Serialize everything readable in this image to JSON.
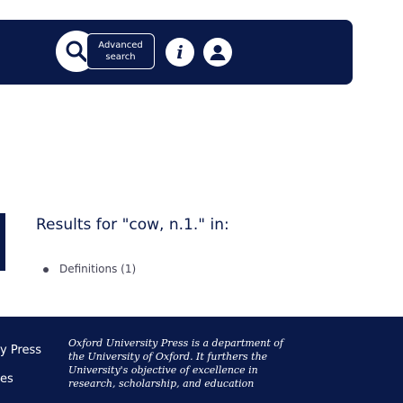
{
  "header": {
    "search_icon": "search-icon",
    "advanced_search": {
      "line1": "Advanced",
      "line2": "search"
    },
    "info_icon": "info-icon",
    "info_glyph": "i",
    "user_icon": "user-icon"
  },
  "results": {
    "title": "Results for \"cow, n.1.\" in:",
    "items": [
      {
        "label": "Definitions (1)"
      }
    ]
  },
  "footer": {
    "nav_items": [
      "y Press",
      "es"
    ],
    "text_lines": [
      "Oxford University Press is a department of",
      "the University of Oxford. It furthers the",
      "University's objective of excellence in",
      "research, scholarship, and education"
    ]
  },
  "colors": {
    "navy": "#0a1a4a",
    "white": "#ffffff",
    "body_text": "#445"
  }
}
